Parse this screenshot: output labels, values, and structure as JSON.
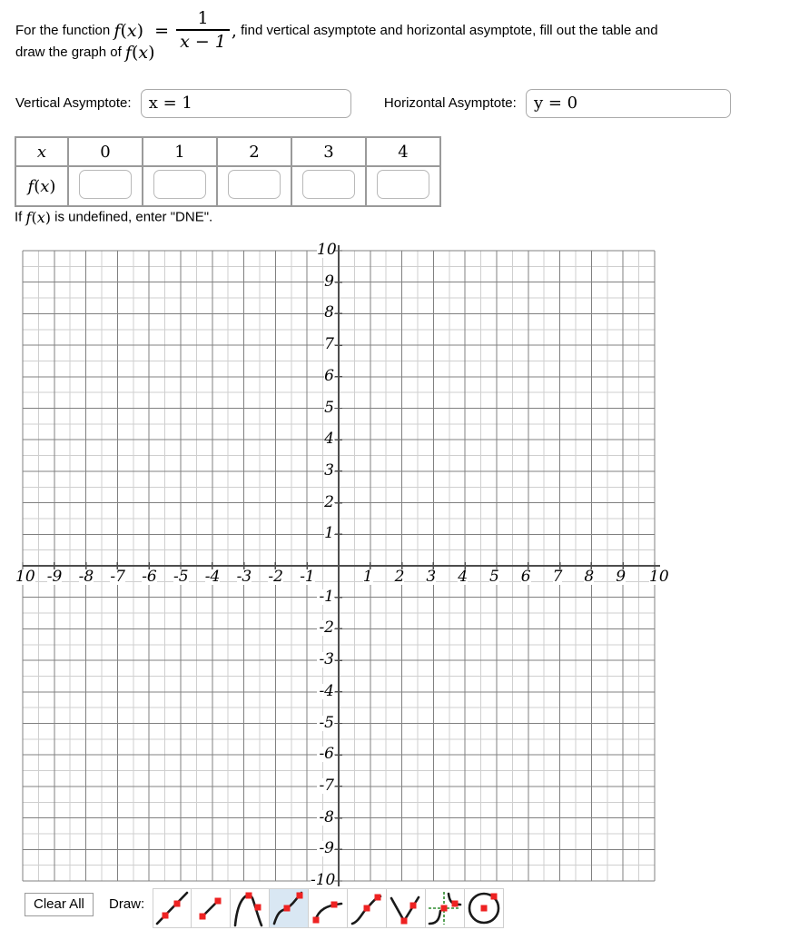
{
  "prompt": {
    "part1": "For the function",
    "fn_lhs": "f(x) =",
    "frac_num": "1",
    "frac_den": "x − 1",
    "comma": ",",
    "part2": "find vertical asymptote and horizontal asymptote, fill out the table and",
    "line2_pre": "draw the graph of",
    "line2_fn": "f(x)"
  },
  "asymptotes": {
    "vertical_label": "Vertical Asymptote:",
    "vertical_value": "x = 1",
    "vertical_placeholder": "",
    "horizontal_label": "Horizontal Asymptote:",
    "horizontal_value": "y = 0",
    "horizontal_placeholder": ""
  },
  "table": {
    "row_header_x": "x",
    "row_header_fx": "f(x)",
    "x_values": [
      "0",
      "1",
      "2",
      "3",
      "4"
    ],
    "fx_values": [
      "",
      "",
      "",
      "",
      ""
    ],
    "fx_placeholder": ""
  },
  "note": "If f(x) is undefined, enter \"DNE\".",
  "graph": {
    "x_tick_labels": [
      "10",
      "-9",
      "-8",
      "-7",
      "-6",
      "-5",
      "-4",
      "-3",
      "-2",
      "-1",
      "1",
      "2",
      "3",
      "4",
      "5",
      "6",
      "7",
      "8",
      "9",
      "10"
    ],
    "y_tick_labels": [
      "10",
      "9",
      "8",
      "7",
      "6",
      "5",
      "4",
      "3",
      "2",
      "1",
      "-1",
      "-2",
      "-3",
      "-4",
      "-5",
      "-6",
      "-7",
      "-8",
      "-9",
      "-10"
    ],
    "x_min": -10,
    "x_max": 10,
    "y_min": -10,
    "y_max": 10,
    "major_grid_color": "#808080",
    "minor_grid_color": "#cfcfcf",
    "axis_color": "#4d4d4d",
    "grid_step_major": 1,
    "grid_step_minor": 0.5
  },
  "toolbar": {
    "clear_all_label": "Clear All",
    "draw_label": "Draw:",
    "selected_tool_index": 3,
    "highlight_color": "#d9e7f3",
    "point_color": "#ee2222",
    "curve_color": "#1a1a1a",
    "asymptote_color": "#2e8b2e",
    "tools": [
      {
        "name": "line-tool",
        "title": "Line"
      },
      {
        "name": "segment-tool",
        "title": "Segment"
      },
      {
        "name": "parabola-tool",
        "title": "Parabola"
      },
      {
        "name": "cubic-tool",
        "title": "Cubic"
      },
      {
        "name": "sqrt-tool",
        "title": "Square Root"
      },
      {
        "name": "cuberoot-tool",
        "title": "Cube Root"
      },
      {
        "name": "absolute-value-tool",
        "title": "Absolute Value"
      },
      {
        "name": "rational-tool",
        "title": "Rational"
      },
      {
        "name": "circle-tool",
        "title": "Circle"
      }
    ]
  }
}
